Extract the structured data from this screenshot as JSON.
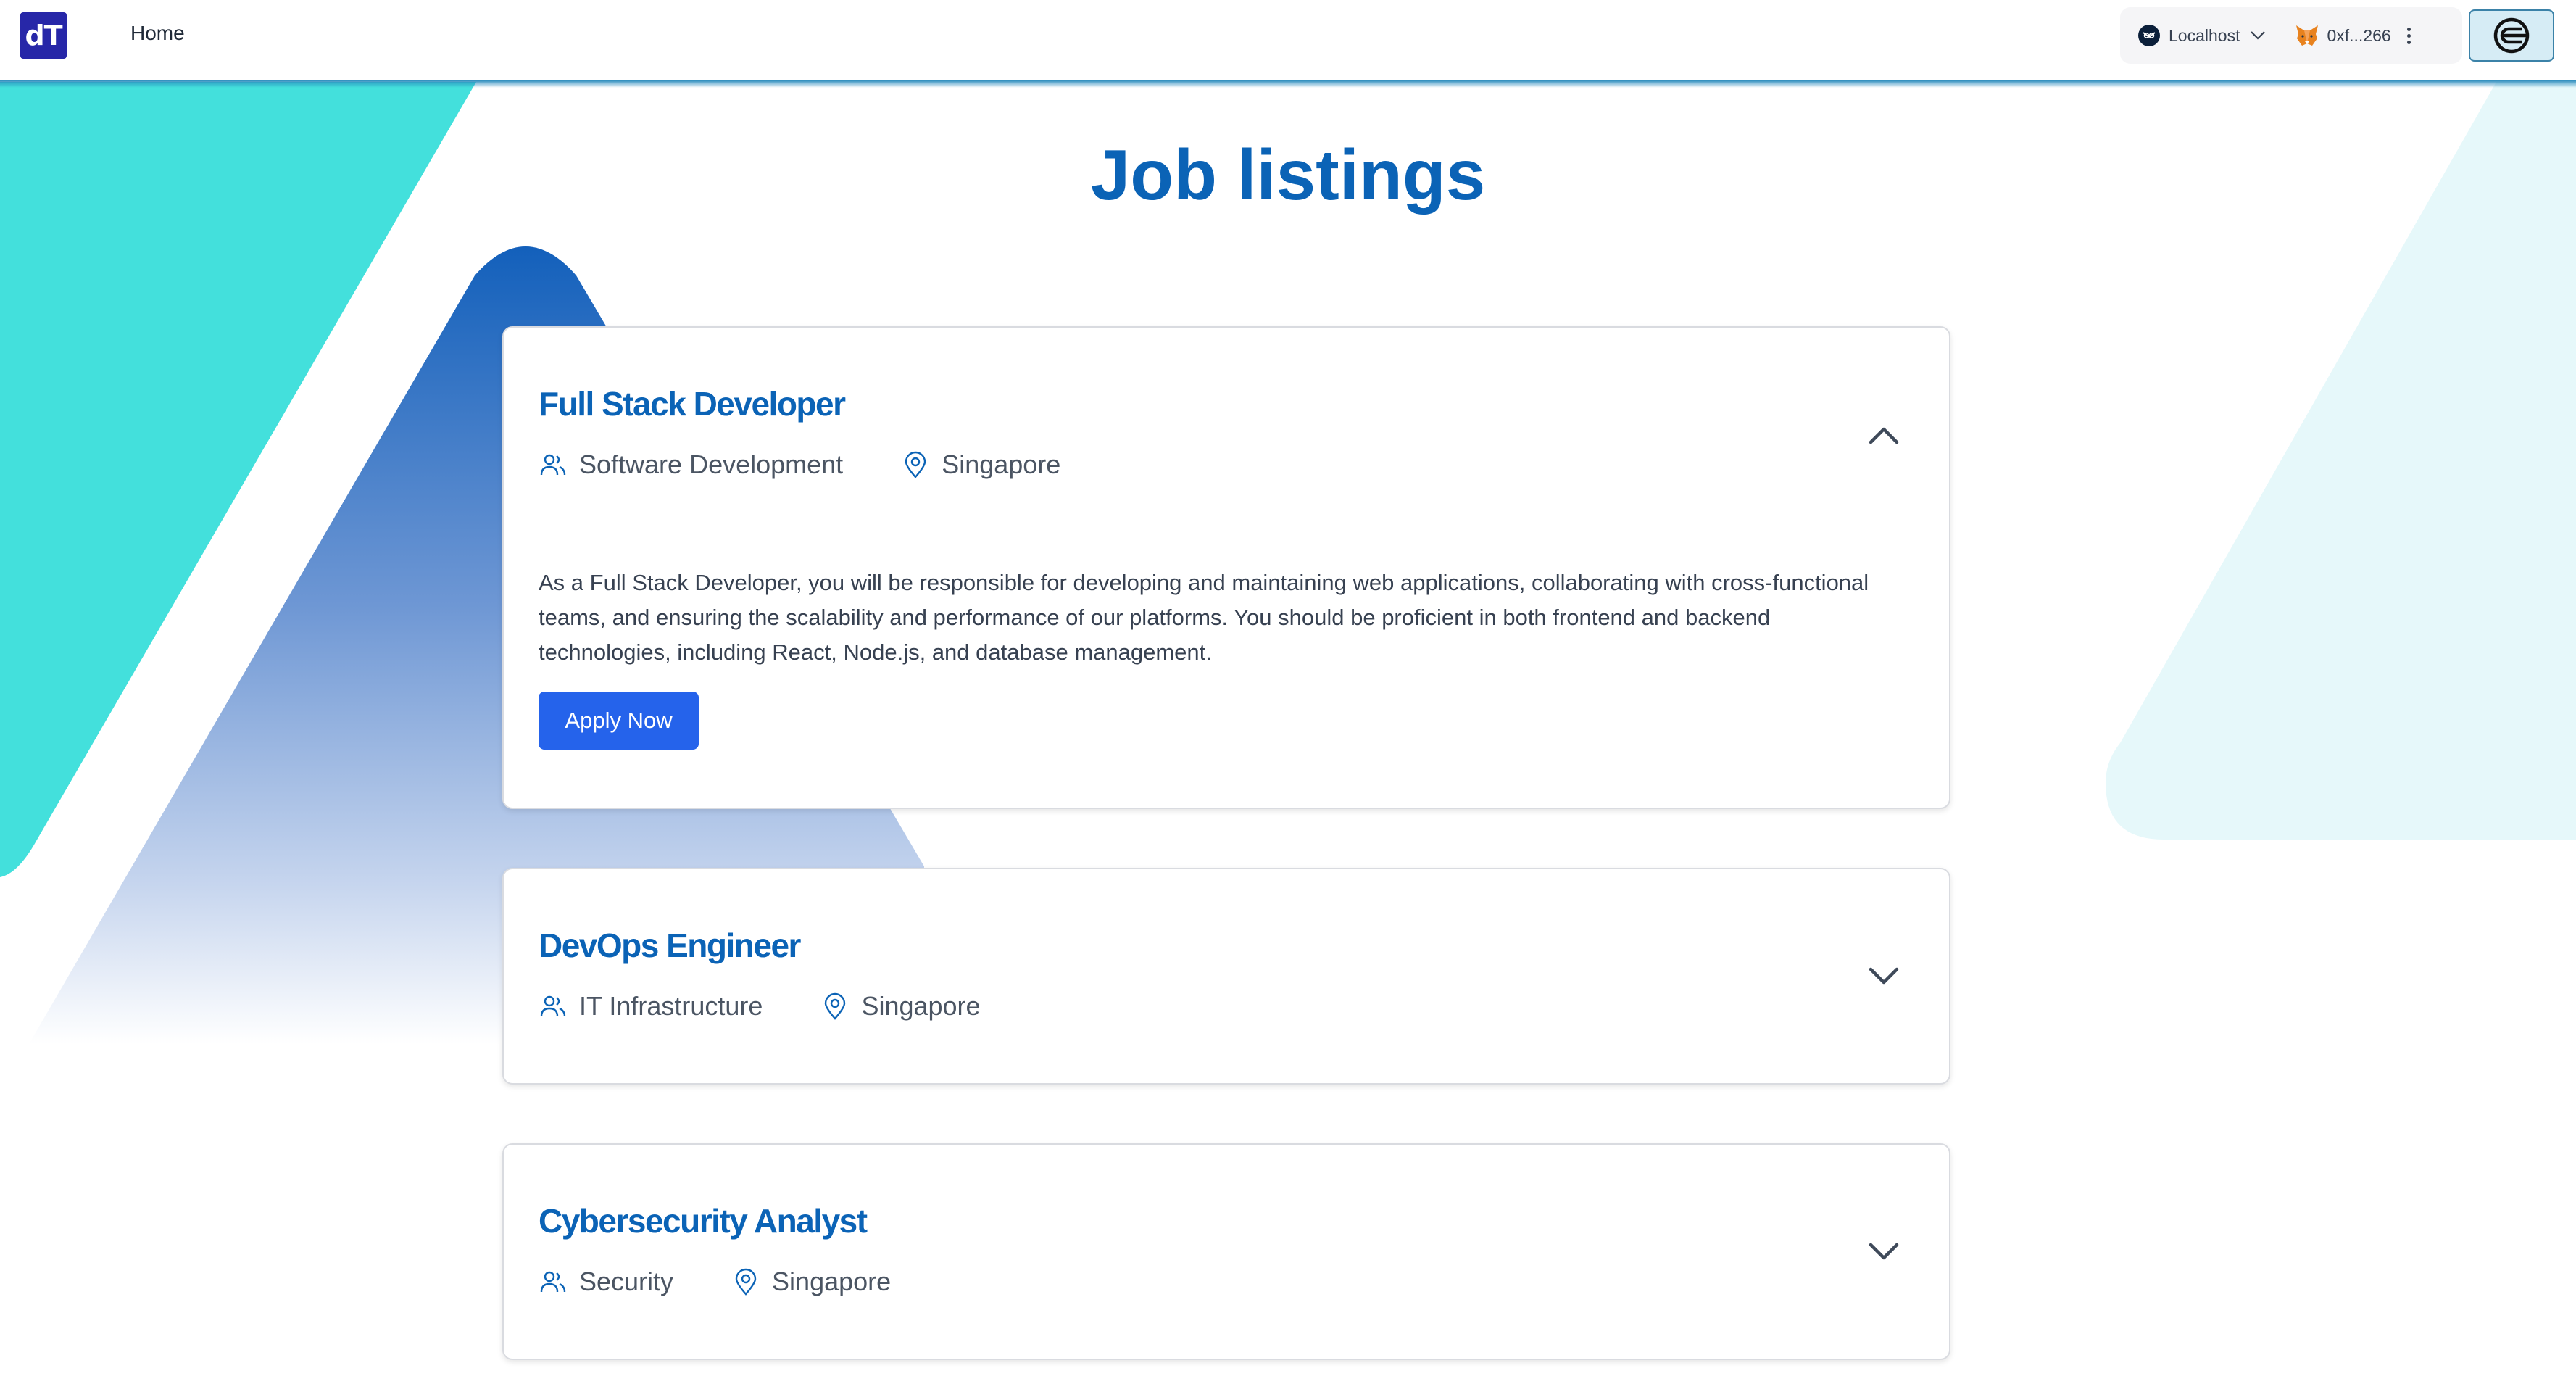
{
  "header": {
    "logo_text": "dT",
    "nav": [
      {
        "label": "Home"
      }
    ],
    "network": {
      "label": "Localhost",
      "icon": "owl-network-icon"
    },
    "account": {
      "label": "0xf...266",
      "icon": "metamask-fox-icon"
    },
    "connect_icon": "worldcoin-icon"
  },
  "page": {
    "title": "Job listings"
  },
  "colors": {
    "brand_blue": "#0b63b6",
    "button_blue": "#2563eb",
    "teal": "#43e0dc",
    "logo_bg": "#2727a8"
  },
  "jobs": [
    {
      "title": "Full Stack Developer",
      "department": "Software Development",
      "location": "Singapore",
      "expanded": true,
      "description": "As a Full Stack Developer, you will be responsible for developing and maintaining web applications, collaborating with cross-functional teams, and ensuring the scalability and performance of our platforms. You should be proficient in both frontend and backend technologies, including React, Node.js, and database management.",
      "apply_label": "Apply Now"
    },
    {
      "title": "DevOps Engineer",
      "department": "IT Infrastructure",
      "location": "Singapore",
      "expanded": false
    },
    {
      "title": "Cybersecurity Analyst",
      "department": "Security",
      "location": "Singapore",
      "expanded": false
    }
  ]
}
